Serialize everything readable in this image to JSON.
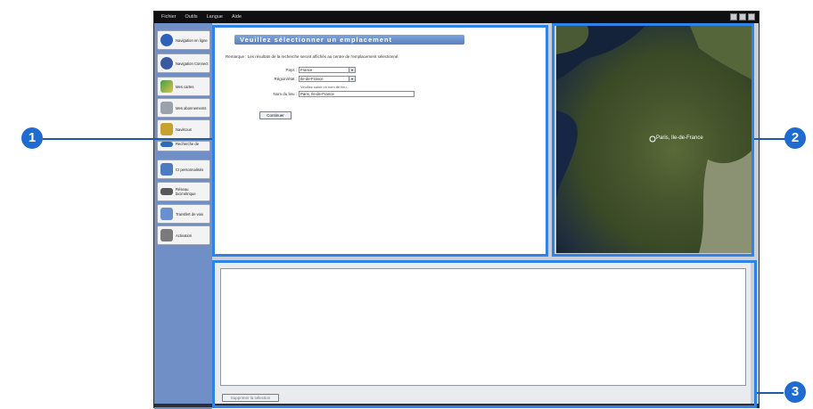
{
  "menu": [
    "Fichier",
    "Outils",
    "Langue",
    "Aide"
  ],
  "sidebar": {
    "items": [
      {
        "label": "Navigation en ligne",
        "icon": "globe-icon",
        "color": "#2d62b8"
      },
      {
        "label": "Navigation Connect",
        "icon": "globe-connect-icon",
        "color": "#3a5aa0"
      },
      {
        "label": "Mes cartes",
        "icon": "maps-icon",
        "color": "#3fa04a"
      },
      {
        "label": "Mes abonnements",
        "icon": "documents-icon",
        "color": "#9aa3ad"
      },
      {
        "label": "NaviKoun",
        "icon": "folder-icon",
        "color": "#c8a12e"
      },
      {
        "label": "Recherche de",
        "icon": "search-icon",
        "color": "#2e6bb8"
      },
      {
        "label": "CI personnalisés",
        "icon": "poi-icon",
        "color": "#4c7bc2"
      },
      {
        "label": "Réseau bicimétrique",
        "icon": "network-icon",
        "color": "#585858"
      },
      {
        "label": "Transfert de voix",
        "icon": "voice-icon",
        "color": "#6a8fd0"
      },
      {
        "label": "Activation",
        "icon": "activation-icon",
        "color": "#7a7a7a"
      }
    ]
  },
  "panel1": {
    "title": "Veuillez sélectionner un emplacement",
    "remark": "Remarque : Les résultats de la recherche seront affichés au centre de l'emplacement sélectionné.",
    "country_label": "Pays :",
    "country_value": "France",
    "region_label": "Région/état :",
    "region_value": "Ile-de-France",
    "place_hint": "Veuillez saisir un nom de lieu.",
    "place_label": "Nom du lieu :",
    "place_value": "Paris, Ile-de-France",
    "continue_label": "Continuer"
  },
  "map": {
    "label": "Paris, Ile-de-France"
  },
  "panel3": {
    "delete_label": "Supprimer la sélection"
  },
  "callouts": [
    "1",
    "2",
    "3"
  ],
  "colors": {
    "callout": "#1f6bd0",
    "highlight": "#2f82e8",
    "sidebar": "#6f8fc6"
  }
}
